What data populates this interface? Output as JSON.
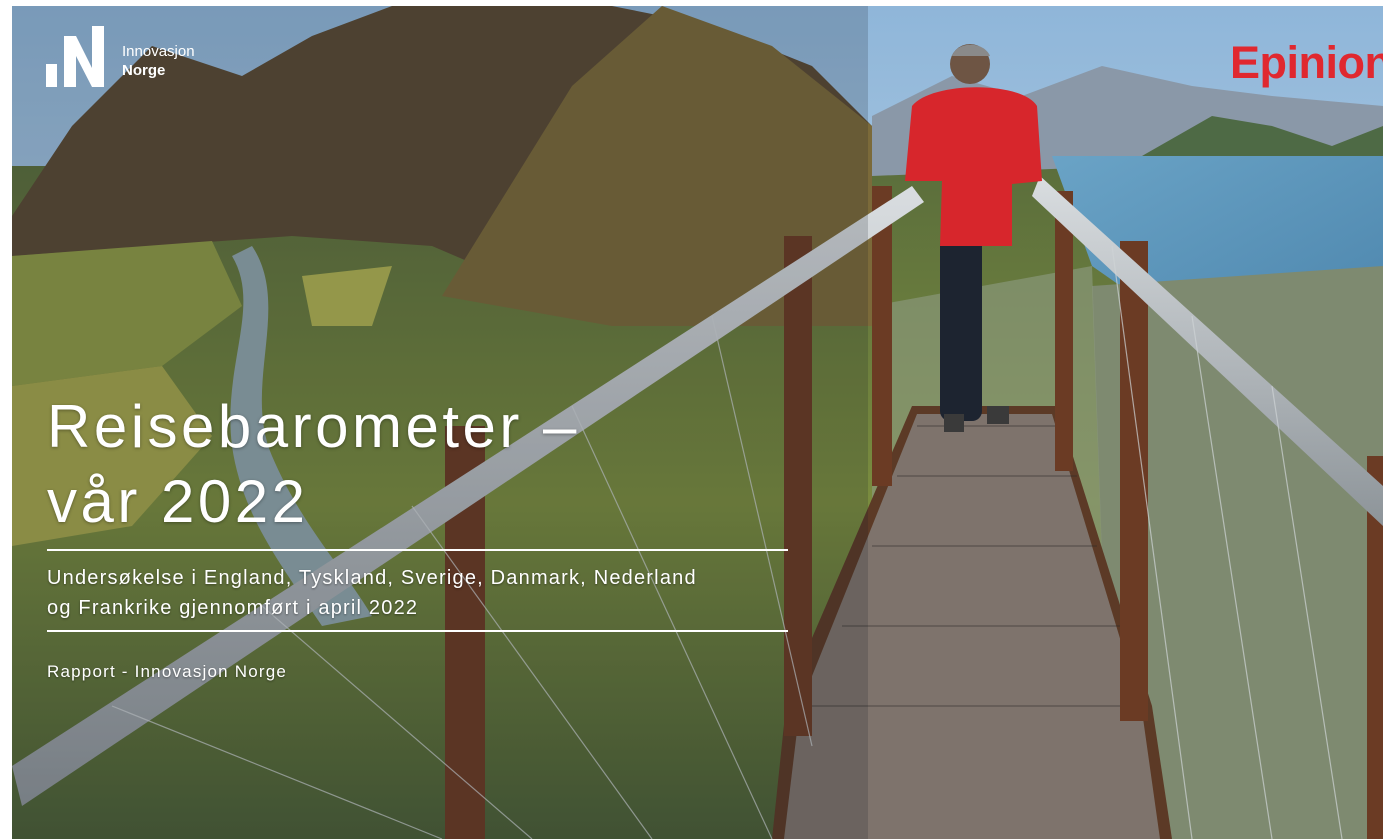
{
  "logo": {
    "line1": "Innovasjon",
    "line2": "Norge"
  },
  "brand": "Epinion",
  "title": {
    "line1": "Reisebarometer –",
    "line2": "vår 2022"
  },
  "subtitle": {
    "line1": "Undersøkelse i England, Tyskland, Sverige, Danmark, Nederland",
    "line2": "og Frankrike gjennomført i april 2022"
  },
  "report_line": "Rapport - Innovasjon Norge",
  "colors": {
    "brand_red": "#e0282f",
    "text": "#ffffff"
  }
}
